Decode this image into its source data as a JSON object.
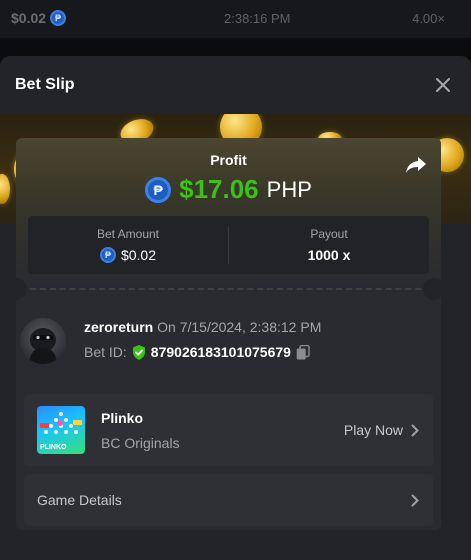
{
  "background": {
    "amount": "$0.02",
    "time": "2:38:16 PM",
    "multiplier": "4.00×"
  },
  "modal": {
    "title": "Bet Slip"
  },
  "profit": {
    "label": "Profit",
    "amount": "$17.06",
    "currency": "PHP",
    "color": "#3bc117"
  },
  "stats": {
    "bet_amount_label": "Bet Amount",
    "bet_amount_value": "$0.02",
    "payout_label": "Payout",
    "payout_value": "1000 x"
  },
  "user": {
    "username": "zeroreturn",
    "on_text": "On 7/15/2024, 2:38:12 PM",
    "bet_id_label": "Bet ID:",
    "bet_id": "879026183101075679"
  },
  "game": {
    "name": "Plinko",
    "provider": "BC Originals",
    "play_label": "Play Now",
    "thumb_text": "PLINKO"
  },
  "details": {
    "label": "Game Details"
  },
  "icons": {
    "coin_symbol": "₱"
  }
}
